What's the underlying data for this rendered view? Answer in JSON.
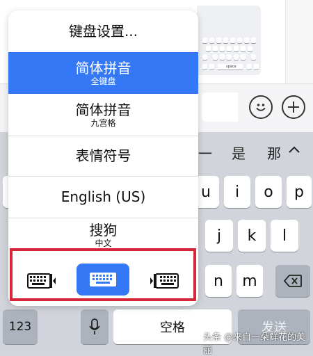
{
  "menu": {
    "items": [
      {
        "label": "键盘设置...",
        "sub": ""
      },
      {
        "label": "简体拼音",
        "sub": "全键盘"
      },
      {
        "label": "简体拼音",
        "sub": "九宫格"
      },
      {
        "label": "表情符号",
        "sub": ""
      },
      {
        "label": "English (US)",
        "sub": ""
      },
      {
        "label": "搜狗",
        "sub": "中文"
      }
    ],
    "selected_index": 1,
    "layout_buttons": [
      "keyboard-left-icon",
      "keyboard-full-icon",
      "keyboard-right-icon"
    ],
    "active_layout": "keyboard-full-icon"
  },
  "candidates": [
    "一",
    "是",
    "那"
  ],
  "keys": {
    "row2": [
      "u",
      "i",
      "o",
      "p"
    ],
    "row3": [
      "j",
      "k",
      "l"
    ],
    "row4": [
      "n",
      "m"
    ],
    "numbers_label": "123",
    "space_label": "空格",
    "send_label": "发送"
  },
  "thumbnail": {
    "space_label": "space"
  },
  "watermark": "头条 @来自一朵鲜花的美丽",
  "colors": {
    "accent": "#3478f6",
    "highlight": "#d7263a"
  }
}
